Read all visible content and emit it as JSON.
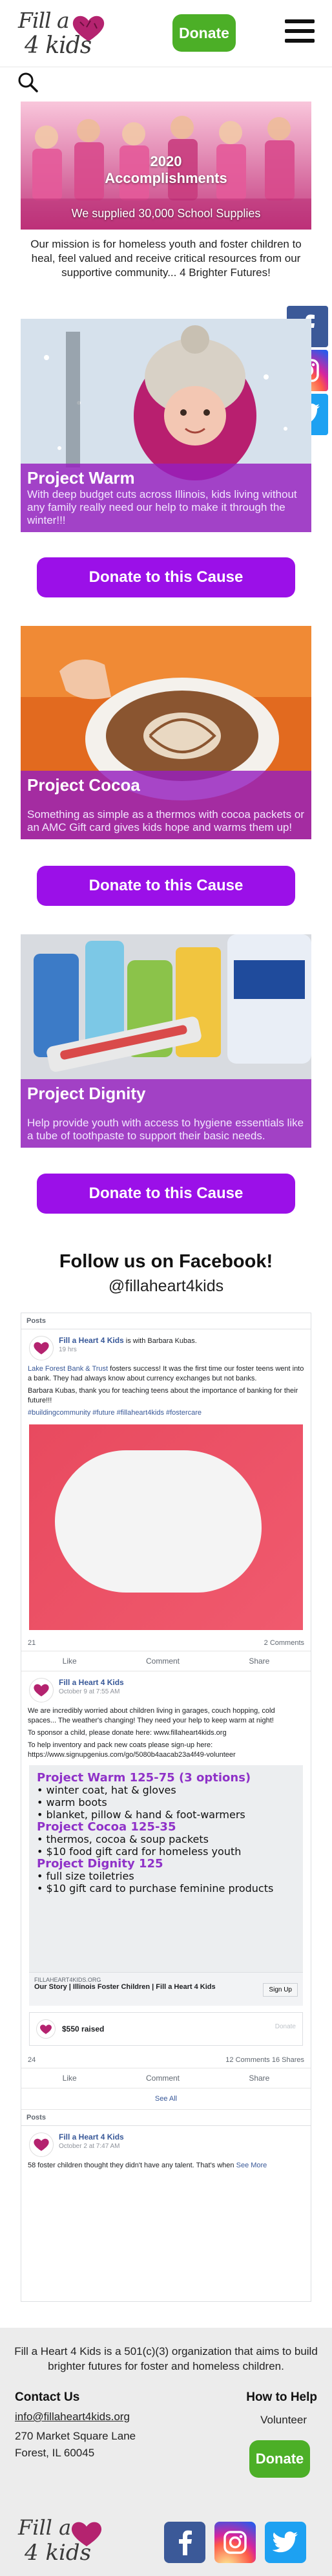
{
  "header": {
    "logo_line1": "Fill a",
    "logo_line2": "4 kids",
    "donate_label": "Donate"
  },
  "hero": {
    "title_line1": "2020",
    "title_line2": "Accomplishments",
    "subtitle": "We supplied 30,000 School Supplies"
  },
  "mission": "Our mission is for homeless youth and foster children to heal, feel valued and receive critical resources from our supportive community... 4 Brighter Futures!",
  "projects": [
    {
      "title": "Project Warm",
      "description": "With deep budget cuts across Illinois, kids living without any family really need our help to make it through the winter!!!",
      "button": "Donate to this Cause"
    },
    {
      "title": "Project Cocoa",
      "description": "Something as simple as a thermos with cocoa packets or an AMC Gift card gives kids hope and warms them up!",
      "button": "Donate to this Cause"
    },
    {
      "title": "Project Dignity",
      "description": "Help provide youth with access to hygiene essentials like a tube of toothpaste to support their basic needs.",
      "button": "Donate to this Cause"
    }
  ],
  "facebook": {
    "heading": "Follow us on Facebook!",
    "handle": "@fillaheart4kids",
    "section_posts": "Posts",
    "post1": {
      "author": "Fill a Heart 4 Kids",
      "with": "is with Barbara Kubas.",
      "time": "19 hrs",
      "text1a": "Lake Forest Bank & Trust",
      "text1b": " fosters success! It was the first time our foster teens went into a bank. They had always know about currency exchanges but not banks.",
      "text2": "Barbara Kubas, thank you for teaching teens about the importance of banking for their future!!!",
      "hashtags": "#buildingcommunity #future #fillaheart4kids #fostercare",
      "reaction_count": "21",
      "comments": "2 Comments"
    },
    "post2": {
      "author": "Fill a Heart 4 Kids",
      "time": "October 9 at 7:55 AM",
      "text1": "We are incredibly worried about children living in garages, couch hopping, cold spaces... The weather's changing! They need your help to keep warm at night!",
      "text2": "To sponsor a child, please donate here: www.fillaheart4kids.org",
      "text3": "To help inventory and pack new coats please sign-up here: https://www.signupgenius.com/go/5080b4aacab23a4f49-volunteer",
      "flyer_h1": "Project Warm 125-75 (3 options)",
      "flyer_l1": "• winter coat, hat & gloves",
      "flyer_l2": "• warm boots",
      "flyer_l3": "• blanket, pillow & hand & foot-warmers",
      "flyer_h2": "Project Cocoa 125-35",
      "flyer_l4": "• thermos, cocoa & soup packets",
      "flyer_l5": "• $10 food gift card for homeless youth",
      "flyer_h3": "Project Dignity 125",
      "flyer_l6": "• full size toiletries",
      "flyer_l7": "• $10 gift card to purchase feminine products",
      "link_domain": "FILLAHEART4KIDS.ORG",
      "link_title": "Our Story | Illinois Foster Children | Fill a Heart 4 Kids",
      "signup": "Sign Up",
      "raised": "$550 raised",
      "raised_donate": "Donate",
      "reaction_count": "24",
      "comments": "12 Comments",
      "shares": "16 Shares"
    },
    "like": "Like",
    "comment": "Comment",
    "share": "Share",
    "see_all": "See All",
    "section_posts2": "Posts",
    "post3": {
      "author": "Fill a Heart 4 Kids",
      "time": "October 2 at 7:47 AM",
      "text": "58 foster children thought they didn't have any talent. That's when",
      "more": "See More"
    }
  },
  "footer": {
    "text": "Fill a Heart 4 Kids is a 501(c)(3) organization that aims to build brighter futures for foster and homeless children.",
    "contact_heading": "Contact Us",
    "email": "info@fillaheart4kids.org",
    "address_line1": "270 Market Square Lane",
    "address_line2": "Forest, IL 60045",
    "help_heading": "How to Help",
    "volunteer": "Volunteer",
    "donate_label": "Donate"
  },
  "icons": {
    "brand_green": "#4caf27",
    "cause_purple": "#9b10e8",
    "facebook_blue": "#3b5998",
    "twitter_blue": "#1da1f2"
  }
}
